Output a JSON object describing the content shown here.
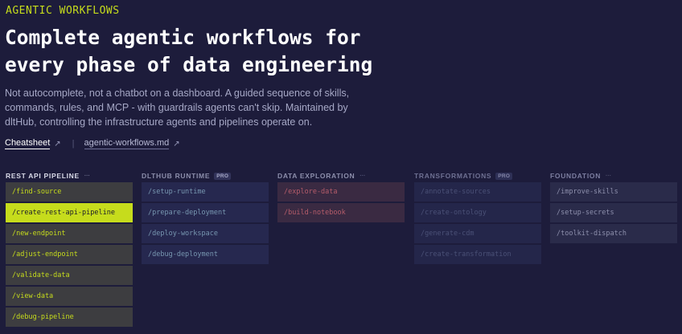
{
  "eyebrow": "AGENTIC WORKFLOWS",
  "headline": {
    "line1": "Complete agentic workflows for",
    "line2": "every phase of data engineering"
  },
  "lede": {
    "line1": "Not autocomplete, not a chatbot on a dashboard. A guided sequence of skills,",
    "line2": "commands, rules, and MCP - with guardrails agents can't skip. Maintained by",
    "line3": "dltHub, controlling the infrastructure agents and pipelines operate on."
  },
  "links": {
    "cheatsheet": "Cheatsheet",
    "file": "agentic-workflows.md",
    "separator": "|",
    "arrow_icon": "external-arrow-icon"
  },
  "columns": [
    {
      "title": "REST API PIPELINE",
      "dots": "···",
      "items": [
        "/find-source",
        "/create-rest-api-pipeline",
        "/new-endpoint",
        "/adjust-endpoint",
        "/validate-data",
        "/view-data",
        "/debug-pipeline"
      ],
      "active_item": "/create-rest-api-pipeline"
    },
    {
      "title": "DLTHUB RUNTIME",
      "badge": "PRO",
      "items": [
        "/setup-runtime",
        "/prepare-deployment",
        "/deploy-workspace",
        "/debug-deployment"
      ]
    },
    {
      "title": "DATA EXPLORATION",
      "dots": "···",
      "items": [
        "/explore-data",
        "/build-notebook"
      ]
    },
    {
      "title": "TRANSFORMATIONS",
      "badge": "PRO",
      "items": [
        "/annotate-sources",
        "/create-ontology",
        "/generate-cdm",
        "/create-transformation"
      ]
    },
    {
      "title": "FOUNDATION",
      "dots": "···",
      "items": [
        "/improve-skills",
        "/setup-secrets",
        "/toolkit-dispatch"
      ]
    }
  ],
  "colors": {
    "background": "#1d1c3b",
    "accent": "#c6dc1c",
    "exploration_text": "#b55c6a"
  }
}
